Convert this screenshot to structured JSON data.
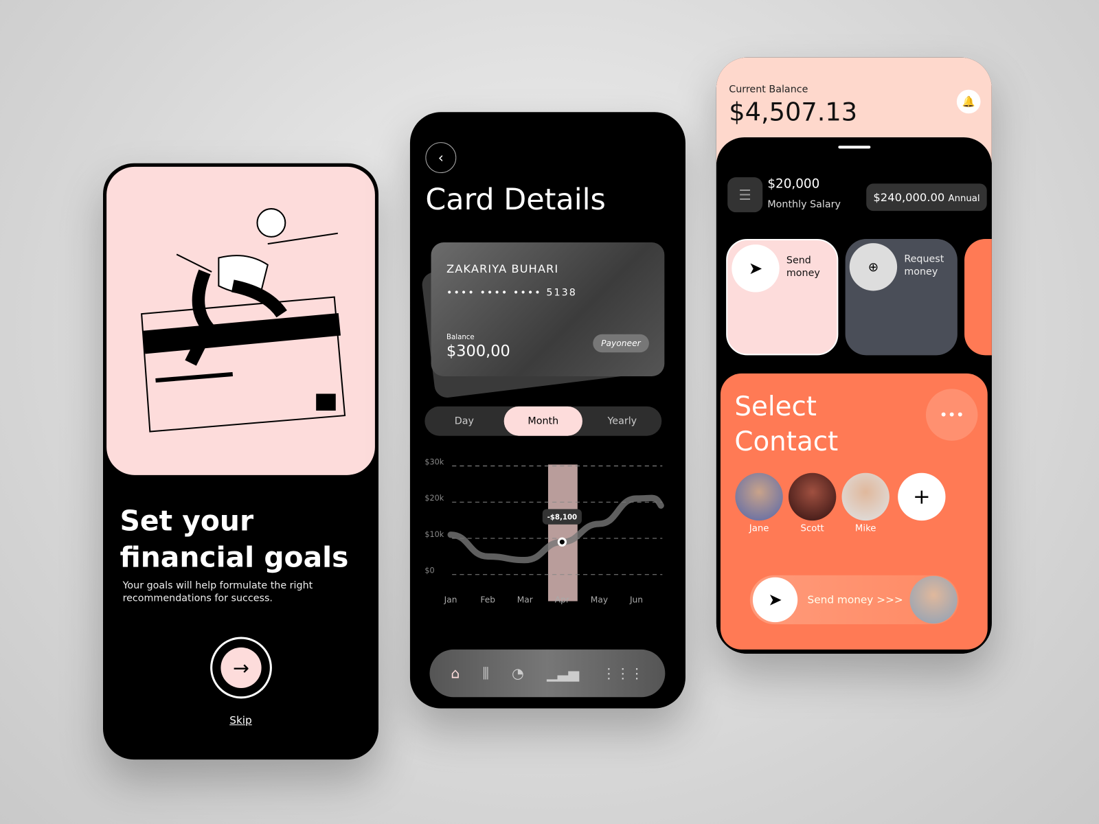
{
  "onboarding": {
    "title": "Set your financial goals",
    "subtitle": "Your goals will help formulate the right recommendations for success.",
    "next_icon": "arrow-right-icon",
    "skip": "Skip"
  },
  "card_details": {
    "title": "Card Details",
    "card": {
      "holder": "ZAKARIYA BUHARI",
      "number": "•••• •••• •••• 5138",
      "balance_label": "Balance",
      "balance": "$300,00",
      "brand": "Payoneer"
    },
    "periods": [
      "Day",
      "Month",
      "Yearly"
    ],
    "active_period": "Month",
    "nav_icons": [
      "home-icon",
      "candlestick-icon",
      "pie-chart-icon",
      "bar-chart-icon",
      "grid-icon"
    ]
  },
  "chart_data": {
    "type": "line",
    "categories": [
      "Jan",
      "Feb",
      "Mar",
      "Apr",
      "May",
      "Jun"
    ],
    "yticks": [
      "$30k",
      "$20k",
      "$10k",
      "$0"
    ],
    "ylim": [
      0,
      30000
    ],
    "values": [
      11000,
      5000,
      4000,
      9000,
      14000,
      21000
    ],
    "highlight": {
      "category": "Apr",
      "label": "-$8,100"
    },
    "grid": true
  },
  "wallet": {
    "balance_label": "Current Balance",
    "balance": "$4,507.13",
    "salary": "$20,000",
    "salary_label": "Monthly Salary",
    "annual": "$240,000.00",
    "annual_label": "Annual",
    "actions": [
      {
        "label": "Send money"
      },
      {
        "label": "Request money"
      }
    ],
    "select_contact": "Select Contact",
    "contacts": [
      "Jane",
      "Scott",
      "Mike"
    ],
    "slider_label": "Send money",
    "slider_arrows": ">>>"
  },
  "colors": {
    "pink": "#fddcdb",
    "orange": "#ff7a55",
    "peach": "#fed8cc"
  }
}
